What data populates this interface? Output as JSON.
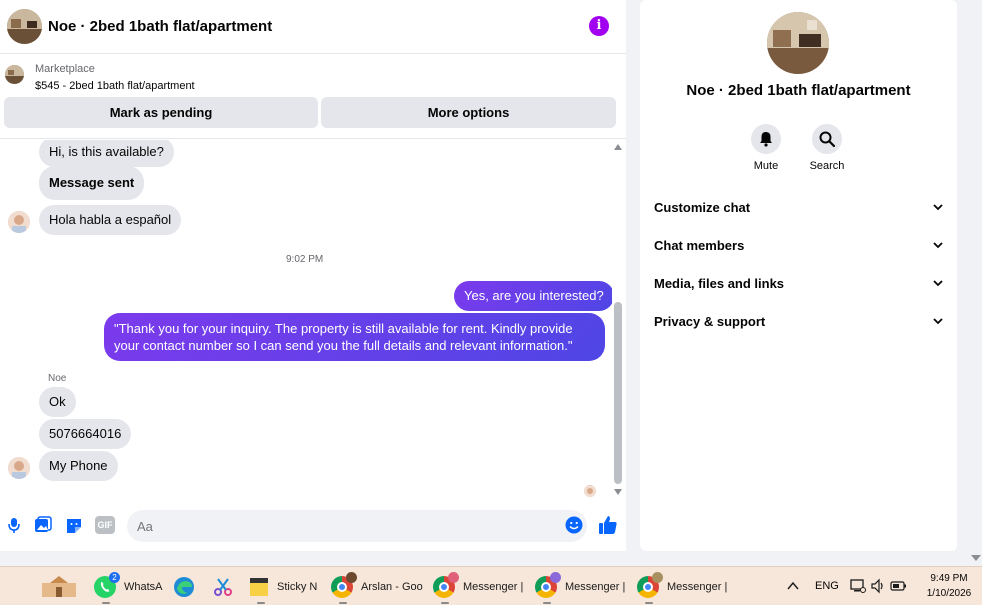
{
  "chat": {
    "title": "Noe · 2bed 1bath flat/apartment",
    "listing": {
      "source": "Marketplace",
      "price_title": "$545 - 2bed 1bath flat/apartment",
      "pending_label": "Mark as pending",
      "options_label": "More options"
    },
    "messages": {
      "msg1": "Hi, is this available?",
      "msg2": "Message sent",
      "msg3": "Hola habla a español",
      "timestamp": "9:02 PM",
      "out1": "Yes, are you interested?",
      "out2": "\"Thank you for your inquiry. The property is still available for rent. Kindly provide your contact number so I can send you the full details and relevant information.\"",
      "sender": "Noe",
      "in1": "Ok",
      "in2": "5076664016",
      "in3": "My Phone"
    },
    "composer": {
      "placeholder": "Aa",
      "gif_label": "GIF"
    },
    "accent": "#6d4aff",
    "info_color": "#a200f0"
  },
  "info_panel": {
    "name": "Noe · 2bed 1bath flat/apartment",
    "mute_label": "Mute",
    "search_label": "Search",
    "sections": [
      {
        "label": "Customize chat"
      },
      {
        "label": "Chat members"
      },
      {
        "label": "Media, files and links"
      },
      {
        "label": "Privacy & support"
      }
    ]
  },
  "taskbar": {
    "whatsapp": {
      "label": "WhatsA",
      "badge": "2"
    },
    "sticky": {
      "label": "Sticky N"
    },
    "arslan": {
      "label": "Arslan - Goo"
    },
    "messenger1": {
      "label": "Messenger |"
    },
    "messenger2": {
      "label": "Messenger |"
    },
    "messenger3": {
      "label": "Messenger |"
    },
    "language": "ENG",
    "time": "9:49 PM",
    "date": "1/10/2026"
  }
}
